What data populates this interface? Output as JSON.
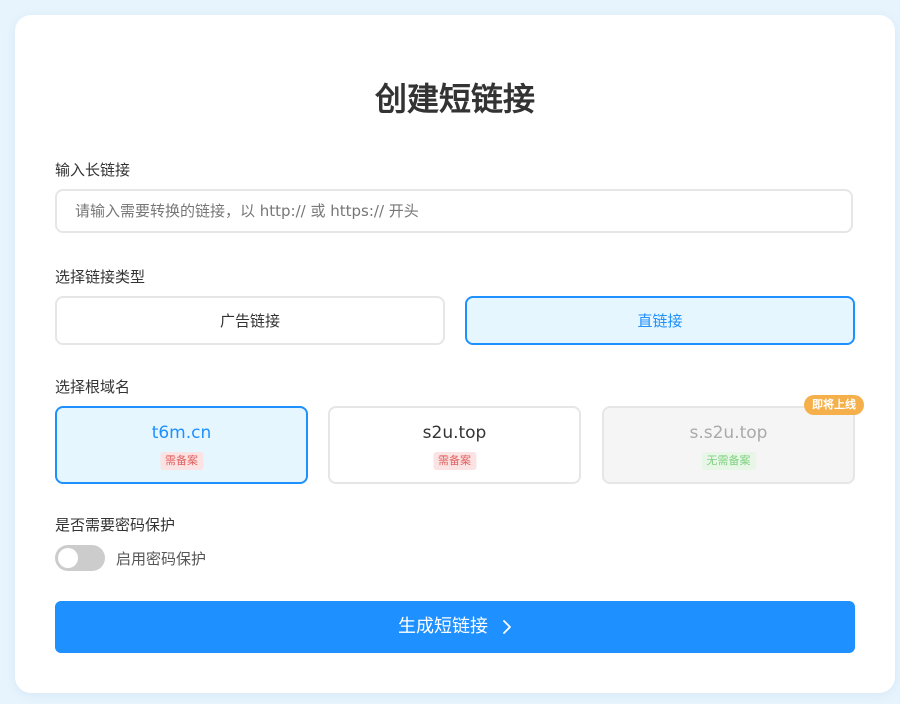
{
  "title": "创建短链接",
  "long_url": {
    "label": "输入长链接",
    "placeholder": "请输入需要转换的链接，以 http:// 或 https:// 开头",
    "value": ""
  },
  "link_type": {
    "label": "选择链接类型",
    "options": [
      {
        "label": "广告链接",
        "selected": false
      },
      {
        "label": "直链接",
        "selected": true
      }
    ]
  },
  "root_domain": {
    "label": "选择根域名",
    "options": [
      {
        "name": "t6m.cn",
        "tag": "需备案",
        "selected": true,
        "disabled": false
      },
      {
        "name": "s2u.top",
        "tag": "需备案",
        "selected": false,
        "disabled": false
      },
      {
        "name": "s.s2u.top",
        "tag": "无需备案",
        "selected": false,
        "disabled": true,
        "badge": "即将上线"
      }
    ]
  },
  "password": {
    "label": "是否需要密码保护",
    "toggle_label": "启用密码保护",
    "enabled": false
  },
  "submit": {
    "label": "生成短链接",
    "icon": "chevron-right-icon"
  },
  "colors": {
    "accent": "#1e90ff",
    "background": "#e7f4fd",
    "tag_red": "#e06262",
    "tag_green": "#7fd17f",
    "badge": "#f5b04c"
  }
}
